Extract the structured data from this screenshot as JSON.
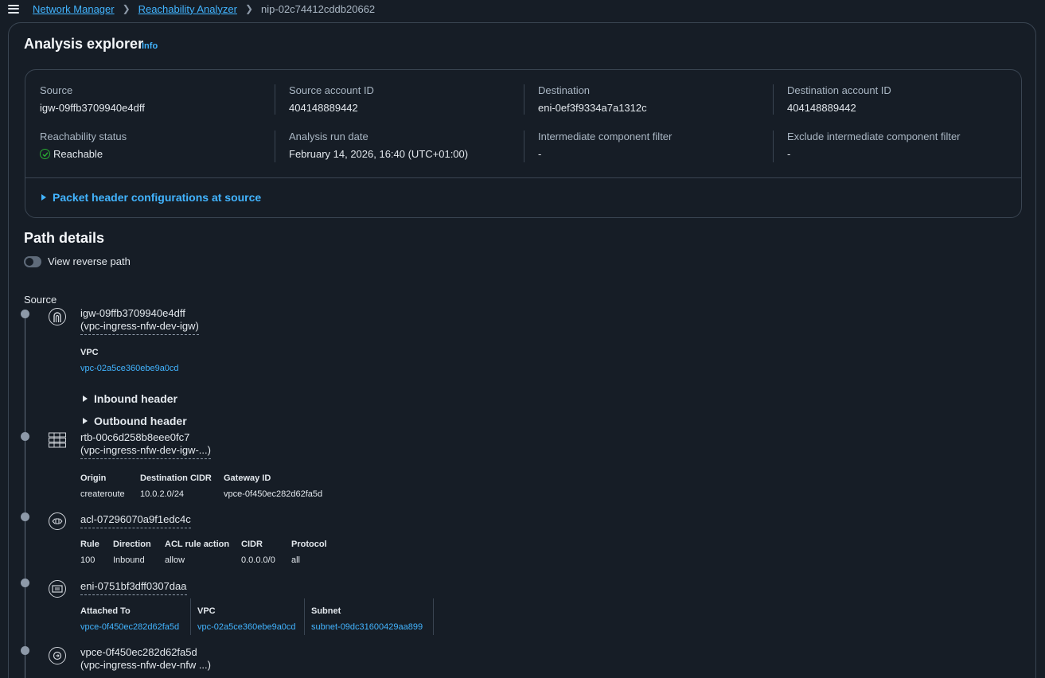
{
  "breadcrumb": {
    "items": [
      "Network Manager",
      "Reachability Analyzer"
    ],
    "current": "nip-02c74412cddb20662"
  },
  "page": {
    "title": "Analysis explorer",
    "info": "Info"
  },
  "summary": {
    "source_label": "Source",
    "source_value": "igw-09ffb3709940e4dff",
    "source_account_label": "Source account ID",
    "source_account_value": "404148889442",
    "destination_label": "Destination",
    "destination_value": "eni-0ef3f9334a7a1312c",
    "destination_account_label": "Destination account ID",
    "destination_account_value": "404148889442",
    "status_label": "Reachability status",
    "status_value": "Reachable",
    "run_date_label": "Analysis run date",
    "run_date_value": "February 14, 2026, 16:40 (UTC+01:00)",
    "intermediate_label": "Intermediate component filter",
    "intermediate_value": "-",
    "exclude_label": "Exclude intermediate component filter",
    "exclude_value": "-",
    "packet_header": "Packet header configurations at source"
  },
  "path": {
    "title": "Path details",
    "toggle_label": "View reverse path",
    "source_label": "Source",
    "igw": {
      "id": "igw-09ffb3709940e4dff",
      "name": "(vpc-ingress-nfw-dev-igw)",
      "vpc_label": "VPC",
      "vpc_value": "vpc-02a5ce360ebe9a0cd",
      "inbound": "Inbound header",
      "outbound": "Outbound header"
    },
    "rtb": {
      "id": "rtb-00c6d258b8eee0fc7",
      "name": "(vpc-ingress-nfw-dev-igw-...)",
      "headers": [
        "Origin",
        "Destination CIDR",
        "Gateway ID"
      ],
      "values": [
        "createroute",
        "10.0.2.0/24",
        "vpce-0f450ec282d62fa5d"
      ]
    },
    "acl": {
      "id": "acl-07296070a9f1edc4c",
      "headers": [
        "Rule",
        "Direction",
        "ACL rule action",
        "CIDR",
        "Protocol"
      ],
      "values": [
        "100",
        "Inbound",
        "allow",
        "0.0.0.0/0",
        "all"
      ]
    },
    "eni": {
      "id": "eni-0751bf3dff0307daa",
      "attached_label": "Attached To",
      "attached_value": "vpce-0f450ec282d62fa5d",
      "vpc_label": "VPC",
      "vpc_value": "vpc-02a5ce360ebe9a0cd",
      "subnet_label": "Subnet",
      "subnet_value": "subnet-09dc31600429aa899"
    },
    "vpce": {
      "id": "vpce-0f450ec282d62fa5d",
      "name": "(vpc-ingress-nfw-dev-nfw ...)"
    }
  },
  "icons": {
    "menu": "hamburger-icon",
    "check": "check-circle-icon",
    "igw": "internet-gateway-icon",
    "rtb": "route-table-icon",
    "acl": "network-acl-icon",
    "eni": "network-interface-icon",
    "vpce": "vpc-endpoint-icon"
  },
  "colors": {
    "background": "#161d26",
    "link": "#42b4ff",
    "success": "#29ad32",
    "border": "#3a4552"
  }
}
